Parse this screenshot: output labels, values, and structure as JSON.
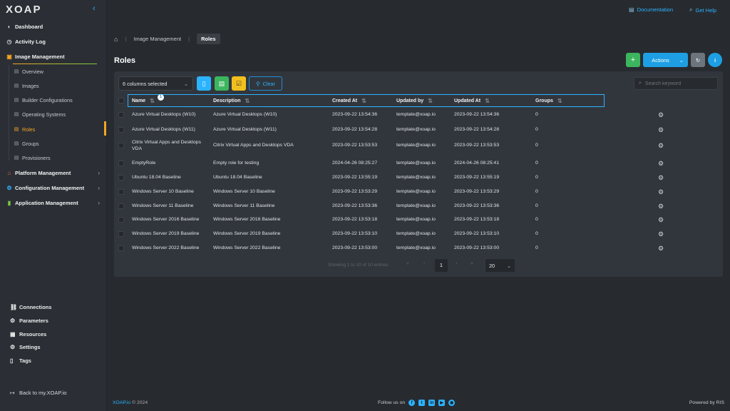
{
  "sidebar": {
    "logo_main": "XOAP",
    "items": [
      {
        "label": "Dashboard",
        "icon": "dashboard-icon"
      },
      {
        "label": "Activity Log",
        "icon": "clock-icon"
      },
      {
        "label": "Image Management",
        "icon": "image-icon"
      },
      {
        "label": "Platform Management",
        "icon": "platform-icon"
      },
      {
        "label": "Configuration Management",
        "icon": "config-icon"
      },
      {
        "label": "Application Management",
        "icon": "chart-icon"
      }
    ],
    "sub_items": [
      "Overview",
      "Images",
      "Builder Configurations",
      "Operating Systems",
      "Roles",
      "Groups",
      "Provisioners"
    ],
    "bottom_items": [
      "Connections",
      "Parameters",
      "Resources",
      "Settings",
      "Tags"
    ],
    "back_link": "Back to my.XOAP.io"
  },
  "topbar": {
    "documentation": "Documentation",
    "get_help": "Get Help"
  },
  "breadcrumb": {
    "section": "Image Management",
    "current": "Roles"
  },
  "page_title": "Roles",
  "actions_label": "Actions",
  "toolbar": {
    "columns_selected": "6 columns selected",
    "clear_label": "Clear",
    "search_placeholder": "Search keyword"
  },
  "table": {
    "headers": [
      "Name",
      "Description",
      "Created At",
      "Updated by",
      "Updated At",
      "Groups"
    ],
    "filter_badge": "1",
    "rows": [
      [
        "Azure Virtual Desktops (W10)",
        "Azure Virtual Desktops (W10)",
        "2023-09-22 13:54:36",
        "template@xoap.io",
        "2023-09-22 13:54:36",
        "0"
      ],
      [
        "Azure Virtual Desktops (W11)",
        "Azure Virtual Desktops (W11)",
        "2023-09-22 13:54:28",
        "template@xoap.io",
        "2023-09-22 13:54:28",
        "0"
      ],
      [
        "Citrix Virtual Apps and Desktops VDA",
        "Citrix Virtual Apps and Desktops VDA",
        "2023-09-22 13:53:53",
        "template@xoap.io",
        "2023-09-22 13:53:53",
        "0"
      ],
      [
        "EmptyRole",
        "Empty role for testing",
        "2024-04-26 08:25:27",
        "template@xoap.io",
        "2024-04-26 08:25:41",
        "0"
      ],
      [
        "Ubuntu 18.04 Baseline",
        "Ubuntu 18.04 Baseline",
        "2023-09-22 13:55:19",
        "template@xoap.io",
        "2023-09-22 13:55:19",
        "0"
      ],
      [
        "Windows Server 10 Baseline",
        "Windows Server 10 Baseline",
        "2023-09-22 13:53:29",
        "template@xoap.io",
        "2023-09-22 13:53:29",
        "0"
      ],
      [
        "Windows Server 11 Baseline",
        "Windows Server 11 Baseline",
        "2023-09-22 13:53:36",
        "template@xoap.io",
        "2023-09-22 13:53:36",
        "0"
      ],
      [
        "Windows Server 2016 Baseline",
        "Windows Server 2016 Baseline",
        "2023-09-22 13:53:18",
        "template@xoap.io",
        "2023-09-22 13:53:18",
        "0"
      ],
      [
        "Windows Server 2019 Baseline",
        "Windows Server 2019 Baseline",
        "2023-09-22 13:53:10",
        "template@xoap.io",
        "2023-09-22 13:53:10",
        "0"
      ],
      [
        "Windows Server 2022 Baseline",
        "Windows Server 2022 Baseline",
        "2023-09-22 13:53:00",
        "template@xoap.io",
        "2023-09-22 13:53:00",
        "0"
      ]
    ]
  },
  "pager": {
    "info": "Showing 1 to 10 of 10 entries",
    "current_page": "1",
    "per_page": "20"
  },
  "footer": {
    "brand": "XOAP.io",
    "copyright": "© 2024",
    "follow_us": "Follow us on",
    "powered_by": "Powered by RIS"
  },
  "colors": {
    "accent_blue": "#2bb3ff",
    "active_orange": "#f5a623",
    "add_green": "#3cb55e",
    "export_yellow": "#f2c01e"
  }
}
